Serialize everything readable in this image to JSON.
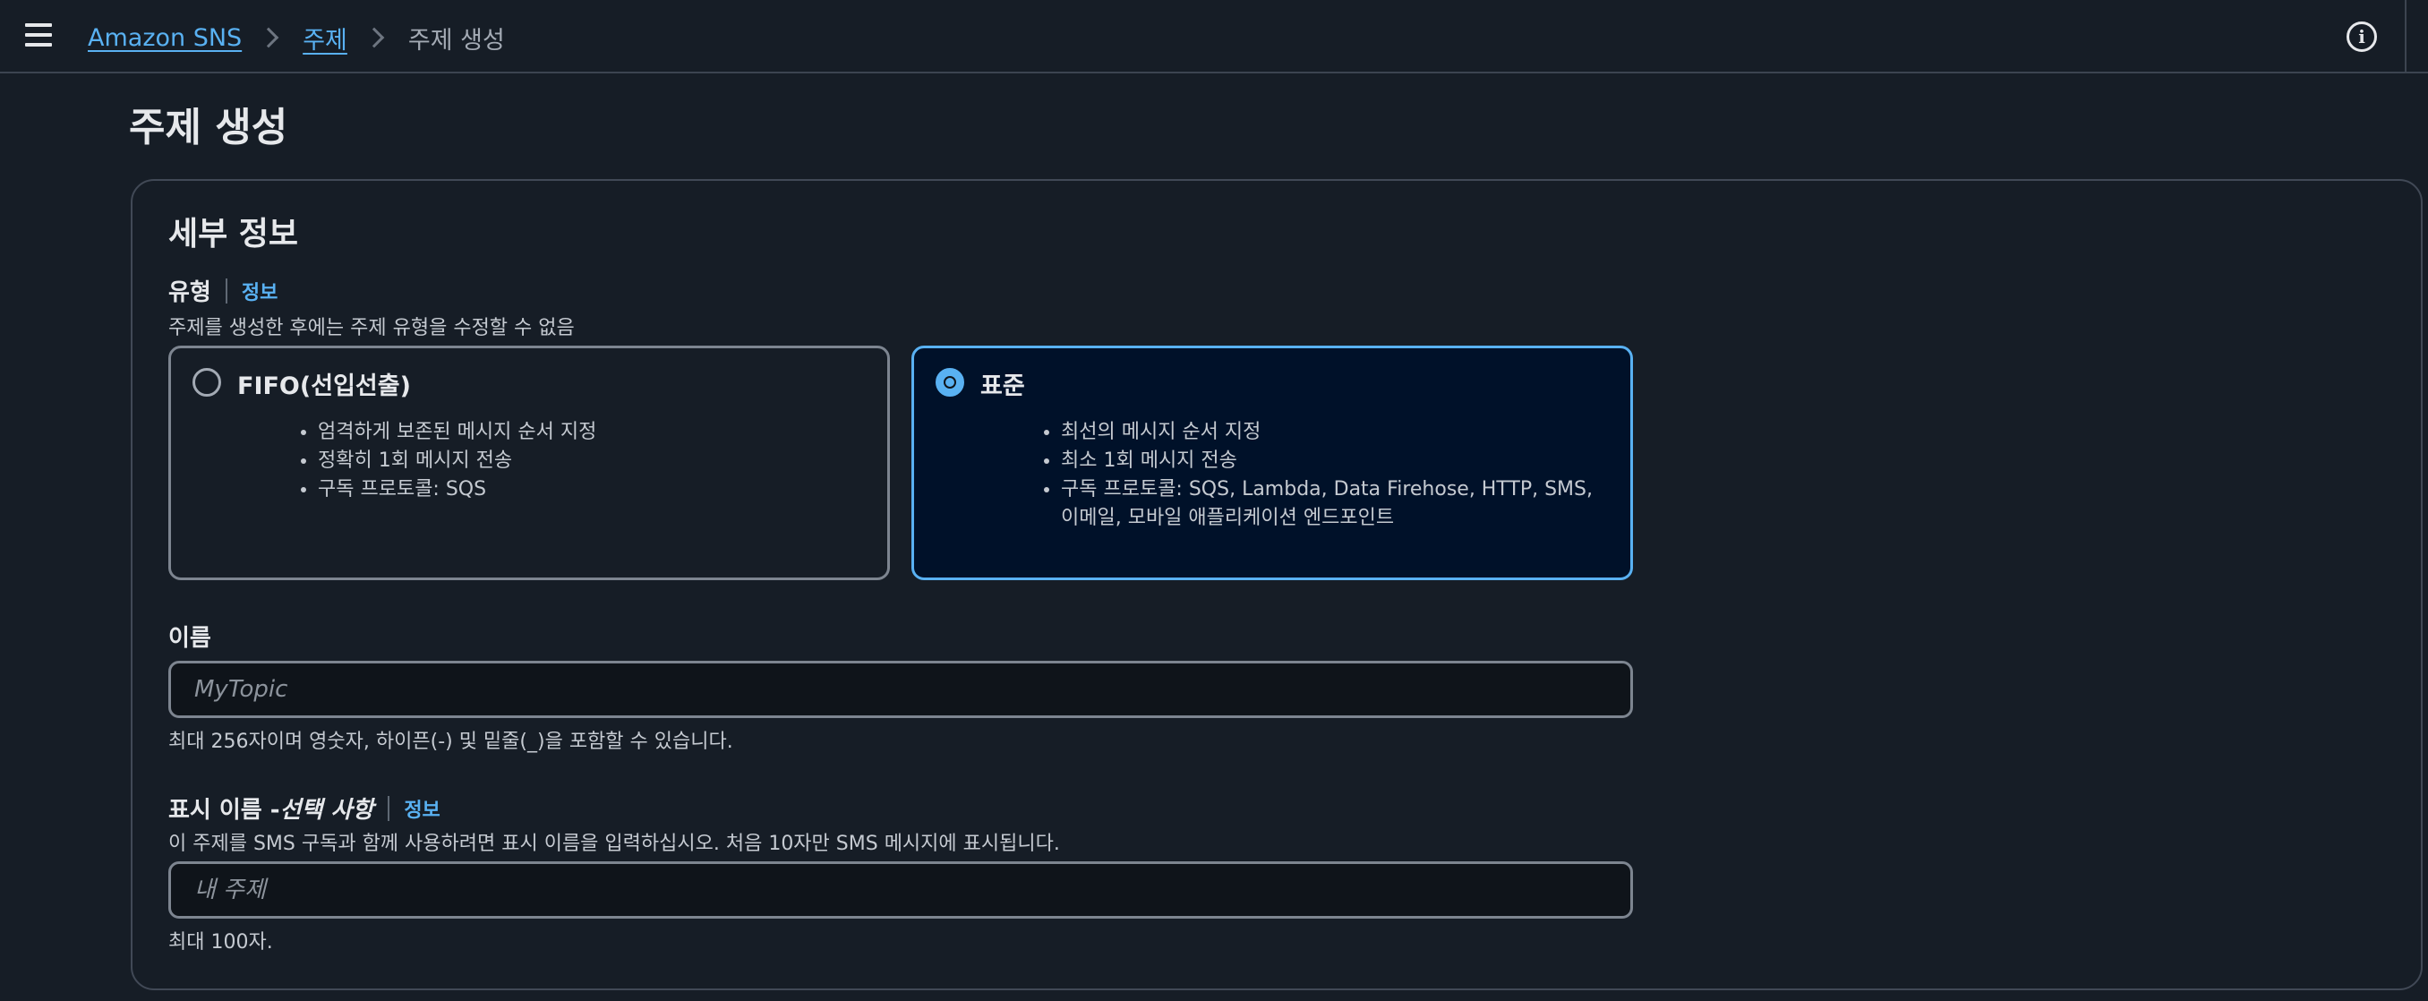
{
  "header": {
    "breadcrumb": [
      {
        "label": "Amazon SNS"
      },
      {
        "label": "주제"
      },
      {
        "label": "주제 생성"
      }
    ],
    "info_icon_glyph": "i"
  },
  "page": {
    "title": "주제 생성"
  },
  "details": {
    "title": "세부 정보",
    "type": {
      "label": "유형",
      "info": "정보",
      "description": "주제를 생성한 후에는 주제 유형을 수정할 수 없음",
      "selected": "standard",
      "options": [
        {
          "id": "fifo",
          "title": "FIFO(선입선출)",
          "features": [
            "엄격하게 보존된 메시지 순서 지정",
            "정확히 1회 메시지 전송",
            "구독 프로토콜: SQS"
          ]
        },
        {
          "id": "standard",
          "title": "표준",
          "features": [
            "최선의 메시지 순서 지정",
            "최소 1회 메시지 전송",
            "구독 프로토콜: SQS, Lambda, Data Firehose, HTTP, SMS, 이메일, 모바일 애플리케이션 엔드포인트"
          ]
        }
      ]
    },
    "name": {
      "label": "이름",
      "value": "",
      "placeholder": "MyTopic",
      "constraint": "최대 256자이며 영숫자, 하이픈(-) 및 밑줄(_)을 포함할 수 있습니다."
    },
    "display_name": {
      "label": "표시 이름 - ",
      "label_optional": "선택 사항",
      "info": "정보",
      "description": "이 주제를 SMS 구독과 함께 사용하려면 표시 이름을 입력하십시오. 처음 10자만 SMS 메시지에 표시됩니다.",
      "value": "",
      "placeholder": "내 주제",
      "constraint": "최대 100자."
    }
  },
  "colors": {
    "background": "#161d26",
    "accent": "#59b1f2",
    "selected_tile_bg": "#001129"
  }
}
